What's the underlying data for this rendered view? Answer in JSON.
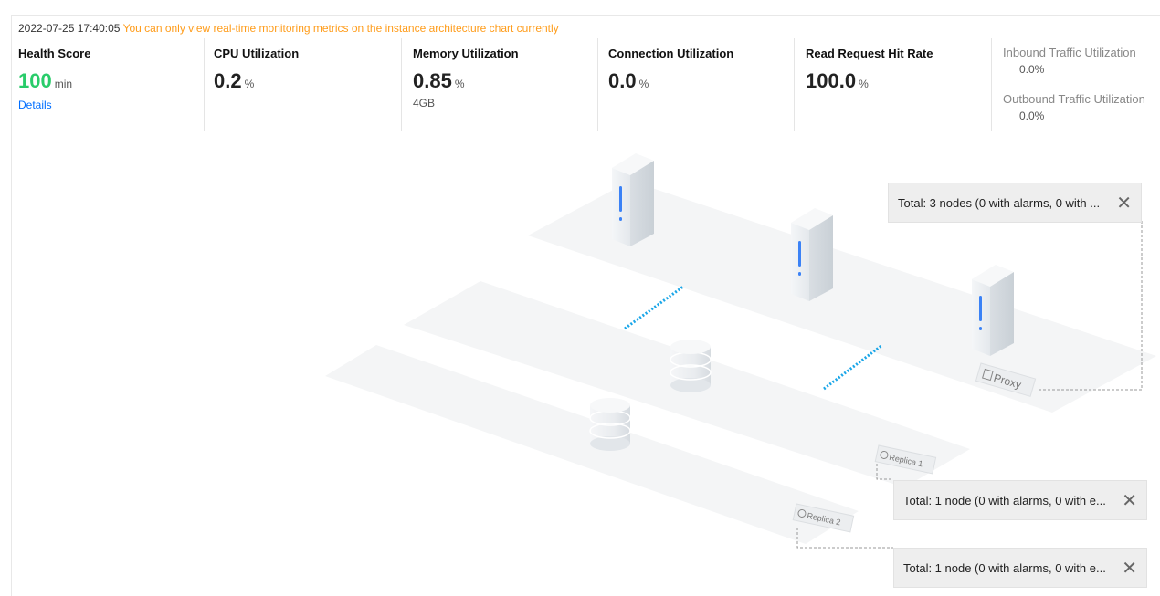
{
  "header": {
    "timestamp": "2022-07-25 17:40:05",
    "notice": "You can only view real-time monitoring metrics on the instance architecture chart currently"
  },
  "metrics": {
    "health": {
      "label": "Health Score",
      "value": "100",
      "unit": "min",
      "link": "Details"
    },
    "cpu": {
      "label": "CPU Utilization",
      "value": "0.2",
      "unit": "%"
    },
    "memory": {
      "label": "Memory Utilization",
      "value": "0.85",
      "unit": "%",
      "sub": "4GB"
    },
    "connection": {
      "label": "Connection Utilization",
      "value": "0.0",
      "unit": "%"
    },
    "read_hit": {
      "label": "Read Request Hit Rate",
      "value": "100.0",
      "unit": "%"
    },
    "inbound": {
      "label": "Inbound Traffic Utilization",
      "value": "0.0%"
    },
    "outbound": {
      "label": "Outbound Traffic Utilization",
      "value": "0.0%"
    }
  },
  "diagram": {
    "proxy_label": "Proxy",
    "replica1_label": "Replica 1",
    "replica2_label": "Replica 2",
    "tooltips": [
      {
        "text": "Total: 3 nodes (0 with alarms, 0 with ..."
      },
      {
        "text": "Total: 1 node (0 with alarms, 0 with e..."
      },
      {
        "text": "Total: 1 node (0 with alarms, 0 with e..."
      }
    ],
    "close_symbol": "✕"
  },
  "colors": {
    "health_green": "#29cc6a",
    "notice_orange": "#ff9c1a",
    "link_blue": "#006eff",
    "server_blue": "#3b82f6",
    "dotted_line": "#1aa6e8"
  },
  "icons": [
    "server-icon",
    "database-icon",
    "close-icon"
  ]
}
